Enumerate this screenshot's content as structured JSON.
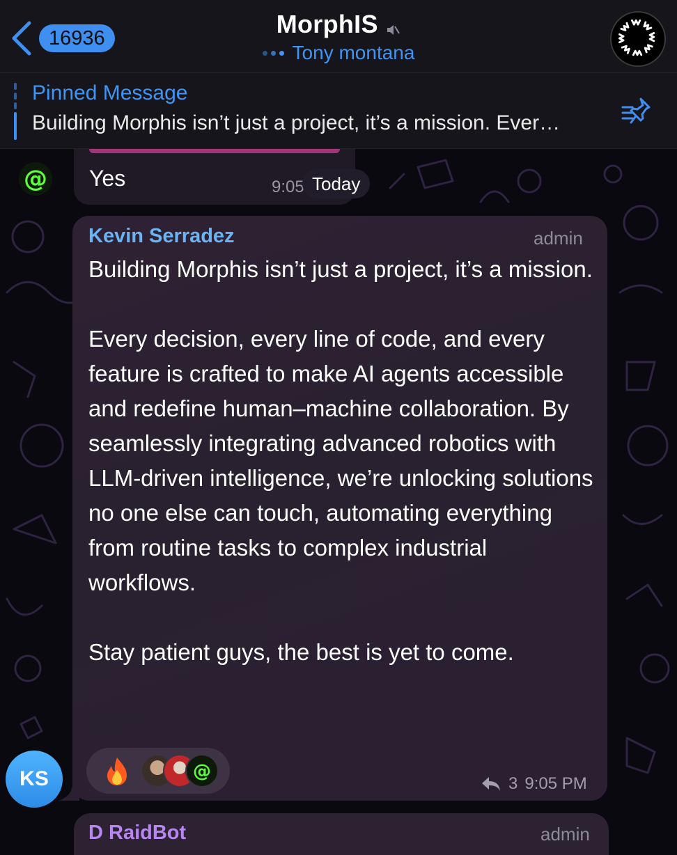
{
  "header": {
    "back_count": "16936",
    "title": "MorphIS",
    "subtitle": "Tony montana",
    "icons": {
      "back": "chevron-left-icon",
      "mute": "mute-icon",
      "avatar": "morphis-logo"
    },
    "accent": "#3e8ff0"
  },
  "pinned": {
    "label": "Pinned Message",
    "text": "Building Morphis isn’t just a project, it’s a mission. Ever…",
    "icon": "pin-list-icon"
  },
  "previous_message": {
    "text": "Yes",
    "time": "9:05",
    "date_label": "Today"
  },
  "message": {
    "sender": "Kevin Serradez",
    "role": "admin",
    "paragraphs": [
      "Building Morphis isn’t just a project, it’s a mission.",
      "Every decision, every line of code, and every feature is crafted to make AI agents accessible and redefine human–machine collaboration. By seamlessly integrating advanced robotics with LLM-driven intelligence, we’re unlocking solutions no one else can touch, automating everything from routine tasks to complex industrial workflows.",
      "Stay patient guys, the best is yet to come."
    ],
    "reaction_emoji": "fire-emoji",
    "reply_count": "3",
    "time": "9:05 PM",
    "avatar_initials": "KS"
  },
  "next_message": {
    "sender": "D RaidBot",
    "role": "admin"
  },
  "colors": {
    "sender_name": "#6ab4f5",
    "next_sender_name": "#b786f2",
    "bubble": "#2b2131",
    "header_bg": "#16151b"
  }
}
